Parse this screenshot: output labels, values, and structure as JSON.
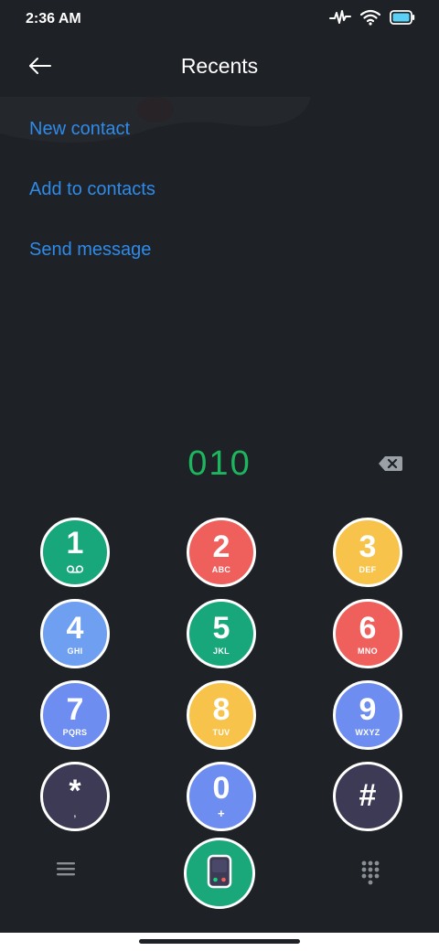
{
  "status_bar": {
    "time": "2:36 AM",
    "icons": [
      "activity-icon",
      "wifi-icon",
      "battery-icon"
    ]
  },
  "header": {
    "title": "Recents",
    "back_icon": "back-arrow-icon"
  },
  "menu": {
    "items": [
      "New contact",
      "Add to contacts",
      "Send message"
    ]
  },
  "dialer": {
    "number": "010",
    "backspace_icon": "backspace-icon"
  },
  "keypad": {
    "keys": [
      {
        "digit": "1",
        "letters": "",
        "sub_icon": "voicemail-icon",
        "color": "#18a77a"
      },
      {
        "digit": "2",
        "letters": "ABC",
        "color": "#ef5f5c"
      },
      {
        "digit": "3",
        "letters": "DEF",
        "color": "#f7c34a"
      },
      {
        "digit": "4",
        "letters": "GHI",
        "color": "#6e9ff0"
      },
      {
        "digit": "5",
        "letters": "JKL",
        "color": "#18a77a"
      },
      {
        "digit": "6",
        "letters": "MNO",
        "color": "#ef5f5c"
      },
      {
        "digit": "7",
        "letters": "PQRS",
        "color": "#6e8df0"
      },
      {
        "digit": "8",
        "letters": "TUV",
        "color": "#f7c34a"
      },
      {
        "digit": "9",
        "letters": "WXYZ",
        "color": "#6e8df0"
      },
      {
        "digit": "*",
        "letters": ",",
        "color": "#3c3a55"
      },
      {
        "digit": "0",
        "letters": "+",
        "color": "#6e8df0"
      },
      {
        "digit": "#",
        "letters": "",
        "color": "#3c3a55"
      }
    ]
  },
  "bottom_bar": {
    "menu_icon": "hamburger-menu-icon",
    "call_icon": "phone-call-icon",
    "call_color": "#1aa87b",
    "dialpad_icon": "dialpad-icon"
  },
  "colors": {
    "background": "#1e2125",
    "accent_link": "#2f8bea",
    "number_text": "#1db55e"
  }
}
